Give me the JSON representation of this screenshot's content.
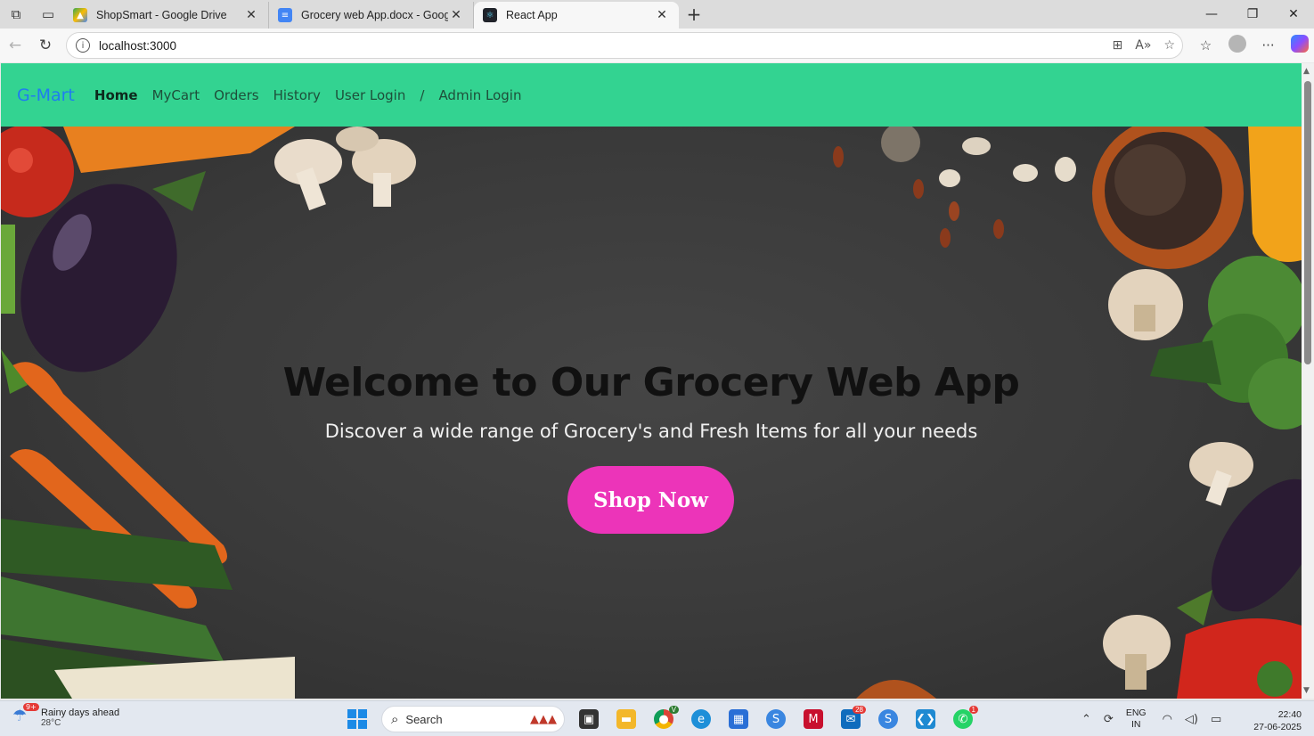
{
  "browser": {
    "tabs": [
      {
        "title": "ShopSmart - Google Drive",
        "favicon": "google-drive-icon",
        "active": false
      },
      {
        "title": "Grocery web App.docx - Google Docs",
        "favicon": "google-docs-icon",
        "active": false
      },
      {
        "title": "React App",
        "favicon": "react-icon",
        "active": true
      }
    ],
    "url": "localhost:3000"
  },
  "page": {
    "brand": "G-Mart",
    "nav": {
      "home": "Home",
      "mycart": "MyCart",
      "orders": "Orders",
      "history": "History",
      "user_login": "User Login",
      "separator": "/",
      "admin_login": "Admin Login"
    },
    "hero": {
      "title": "Welcome to Our Grocery Web App",
      "subtitle": "Discover a wide range of Grocery's and Fresh Items for all your needs",
      "cta": "Shop Now"
    },
    "colors": {
      "navbar": "#33d391",
      "brand": "#1f7cf0",
      "cta": "#ec34b9"
    }
  },
  "taskbar": {
    "weather": {
      "badge": "9+",
      "line1": "Rainy days ahead",
      "line2": "28°C"
    },
    "search_placeholder": "Search",
    "badges": {
      "chrome": "V",
      "outlook": "28",
      "whatsapp": "1"
    },
    "lang": {
      "line1": "ENG",
      "line2": "IN"
    },
    "clock": {
      "time": "22:40",
      "date": "27-06-2025"
    }
  }
}
